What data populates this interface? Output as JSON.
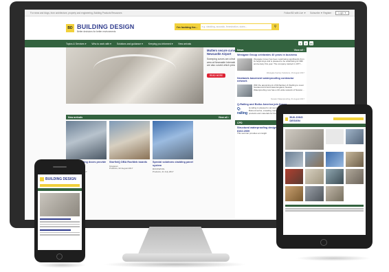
{
  "site": {
    "top_strip": {
      "left_text": "For news and blogs, from architecture, property and engineering, Building Products Resources",
      "follow": "Follow BD with Live ▼",
      "subscribe": "Subscribe ▼ Register",
      "login": "Login ▼"
    },
    "logo": {
      "badge": "BD",
      "title": "BUILDING DESIGN",
      "tagline": "Better decisions for better environments"
    },
    "search": {
      "label": "I'm looking for...",
      "placeholder": "e.g. cladding, acoustic, fenestration, stairs..."
    },
    "nav": [
      "Topics & Services ▾",
      "Who to work with ▾",
      "Solutions and guidance ▾",
      "Keeping you informed ▾",
      "New arrivals"
    ],
    "social": [
      "t",
      "f",
      "in"
    ],
    "hero": {
      "title": "Mutters secure curved shopfronts at Newcastle Airport",
      "body": "Sweeping curves are a feature of the Duty Free retail area at Newcastle International Airport. The shopfronts are also curved which presented a challenge...",
      "read_more": "READ MORE",
      "pager": "< >"
    },
    "news": {
      "heading": "News",
      "view_all": "View all ›",
      "items": [
        {
          "title": "Westgate Group celebrates 40 years in business",
          "body": "Westgate Group has been celebrating significantly from its beginnings and is pleased to be celebrating its 40th anniversary this year. The company started in 1977...",
          "date": "Westgate Factory Solutions, 16 August 2017"
        },
        {
          "title": "Newlands basement waterproofing contractor network",
          "body": "With the appointment of Richardson & Starling to cover Scotland and North East England, Newton Waterproofing now has a UK-wide network of Newton...",
          "date": "Newton Waterproofing, 01 August 2017"
        },
        {
          "title": "Q-Railing and Boiko America join forces",
          "logo": "Q-railing",
          "body": "Q-railing is pleased to announce a new partnership with Boiko America, a leading manufacturer and distributor of products and materials for the glass...",
          "date": "Q-railing, 27 June 2017"
        }
      ]
    },
    "cpd": {
      "heading": "CPD",
      "view_all": "View all ›",
      "title": "Structural waterproofing design strategies: BS 8102:2009",
      "body": "This seminar provides an insight"
    },
    "events": {
      "heading": "New arrivals",
      "view_all": "View all ›",
      "cards": [
        {
          "title": "Automatic sliding doors provide fast access for",
          "meta1": "Record Ltd",
          "meta2": "Products, 23 July 2017"
        },
        {
          "title": "StorfixIQ DBA Roofdek boards",
          "meta1": "Kingspan",
          "meta2": "Products, 02 August 2017"
        },
        {
          "title": "Special solutions cladding panel system",
          "meta1": "ROCKWOOL",
          "meta2": "Products, 21 July 2017"
        }
      ]
    }
  },
  "devices": {
    "tablet": {
      "logo": "BUILDING DESIGN"
    },
    "phone": {
      "logo": "BUILDING DESIGN"
    }
  },
  "colors": {
    "brand_green": "#33633f",
    "brand_yellow": "#f2d13b",
    "link_blue": "#2e3a8c",
    "device_frame": "#2b2b2b"
  }
}
